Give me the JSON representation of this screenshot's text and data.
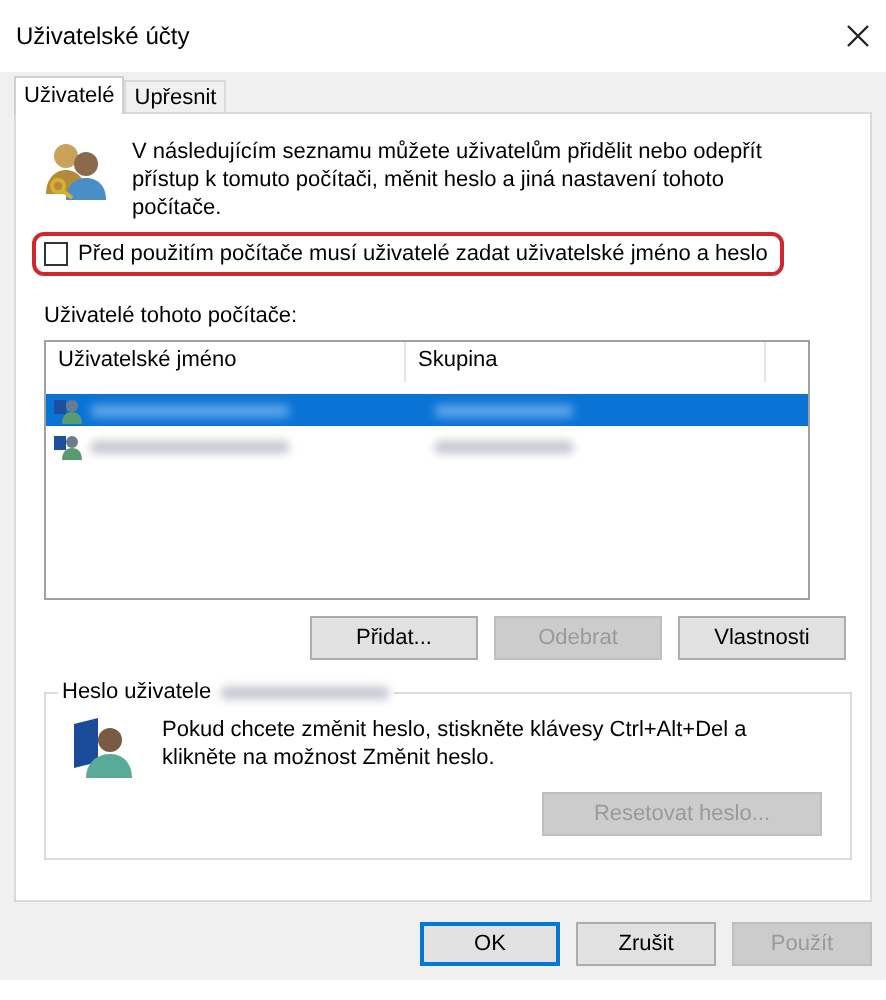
{
  "window": {
    "title": "Uživatelské účty"
  },
  "tabs": [
    {
      "label": "Uživatelé",
      "selected": true
    },
    {
      "label": "Upřesnit",
      "selected": false
    }
  ],
  "intro": "V následujícím seznamu můžete uživatelům přidělit nebo odepřít přístup k tomuto počítači, měnit heslo a jiná nastavení tohoto počítače.",
  "require_login": {
    "label": "Před použitím počítače musí uživatelé zadat uživatelské jméno a heslo",
    "checked": false,
    "highlighted": true
  },
  "users": {
    "label": "Uživatelé tohoto počítače:",
    "columns": [
      "Uživatelské jméno",
      "Skupina"
    ],
    "rows": [
      {
        "selected": true
      },
      {
        "selected": false
      }
    ]
  },
  "user_buttons": [
    {
      "label": "Přidat...",
      "disabled": false
    },
    {
      "label": "Odebrat",
      "disabled": true
    },
    {
      "label": "Vlastnosti",
      "disabled": false
    }
  ],
  "password": {
    "legend": "Heslo uživatele",
    "text": "Pokud chcete změnit heslo, stiskněte klávesy Ctrl+Alt+Del a klikněte na možnost Změnit heslo.",
    "button": {
      "label": "Resetovat heslo...",
      "disabled": true
    }
  },
  "footer_buttons": [
    {
      "label": "OK",
      "disabled": false,
      "default": true
    },
    {
      "label": "Zrušit",
      "disabled": false,
      "default": false
    },
    {
      "label": "Použít",
      "disabled": true,
      "default": false
    }
  ]
}
